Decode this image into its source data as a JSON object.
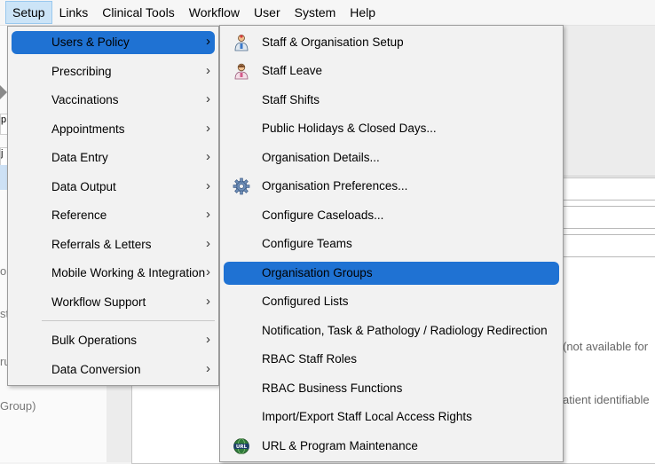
{
  "menubar": {
    "items": [
      "Setup",
      "Links",
      "Clinical Tools",
      "Workflow",
      "User",
      "System",
      "Help"
    ]
  },
  "setup_menu": {
    "items": [
      {
        "label": "Users & Policy",
        "submenu": true
      },
      {
        "label": "Prescribing",
        "submenu": true
      },
      {
        "label": "Vaccinations",
        "submenu": true
      },
      {
        "label": "Appointments",
        "submenu": true
      },
      {
        "label": "Data Entry",
        "submenu": true
      },
      {
        "label": "Data Output",
        "submenu": true
      },
      {
        "label": "Reference",
        "submenu": true
      },
      {
        "label": "Referrals & Letters",
        "submenu": true
      },
      {
        "label": "Mobile Working & Integration",
        "submenu": true
      },
      {
        "label": "Workflow Support",
        "submenu": true
      },
      {
        "label": "Bulk Operations",
        "submenu": true
      },
      {
        "label": "Data Conversion",
        "submenu": true
      }
    ],
    "highlighted": "Users & Policy"
  },
  "users_policy_menu": {
    "items": [
      {
        "label": "Staff & Organisation Setup",
        "icon": "staff-doctor-icon"
      },
      {
        "label": "Staff Leave",
        "icon": "staff-leave-icon"
      },
      {
        "label": "Staff Shifts"
      },
      {
        "label": "Public Holidays & Closed Days..."
      },
      {
        "label": "Organisation Details..."
      },
      {
        "label": "Organisation Preferences...",
        "icon": "gear-icon"
      },
      {
        "label": "Configure Caseloads..."
      },
      {
        "label": "Configure Teams"
      },
      {
        "label": "Organisation Groups"
      },
      {
        "label": "Configured Lists"
      },
      {
        "label": "Notification, Task & Pathology / Radiology Redirection"
      },
      {
        "label": "RBAC Staff Roles"
      },
      {
        "label": "RBAC Business Functions"
      },
      {
        "label": "Import/Export Staff Local Access Rights"
      },
      {
        "label": "URL & Program Maintenance",
        "icon": "url-globe-icon"
      }
    ],
    "highlighted": "Organisation Groups"
  },
  "background": {
    "strip_texts": [
      "p",
      "j"
    ],
    "left_fragments": [
      "ou",
      "st",
      "ru",
      "Group)"
    ],
    "right_fragments": [
      "(not available for",
      "atient identifiable"
    ]
  },
  "colors": {
    "highlight": "#1f72d3",
    "menubar_open": "#cce4f7"
  }
}
